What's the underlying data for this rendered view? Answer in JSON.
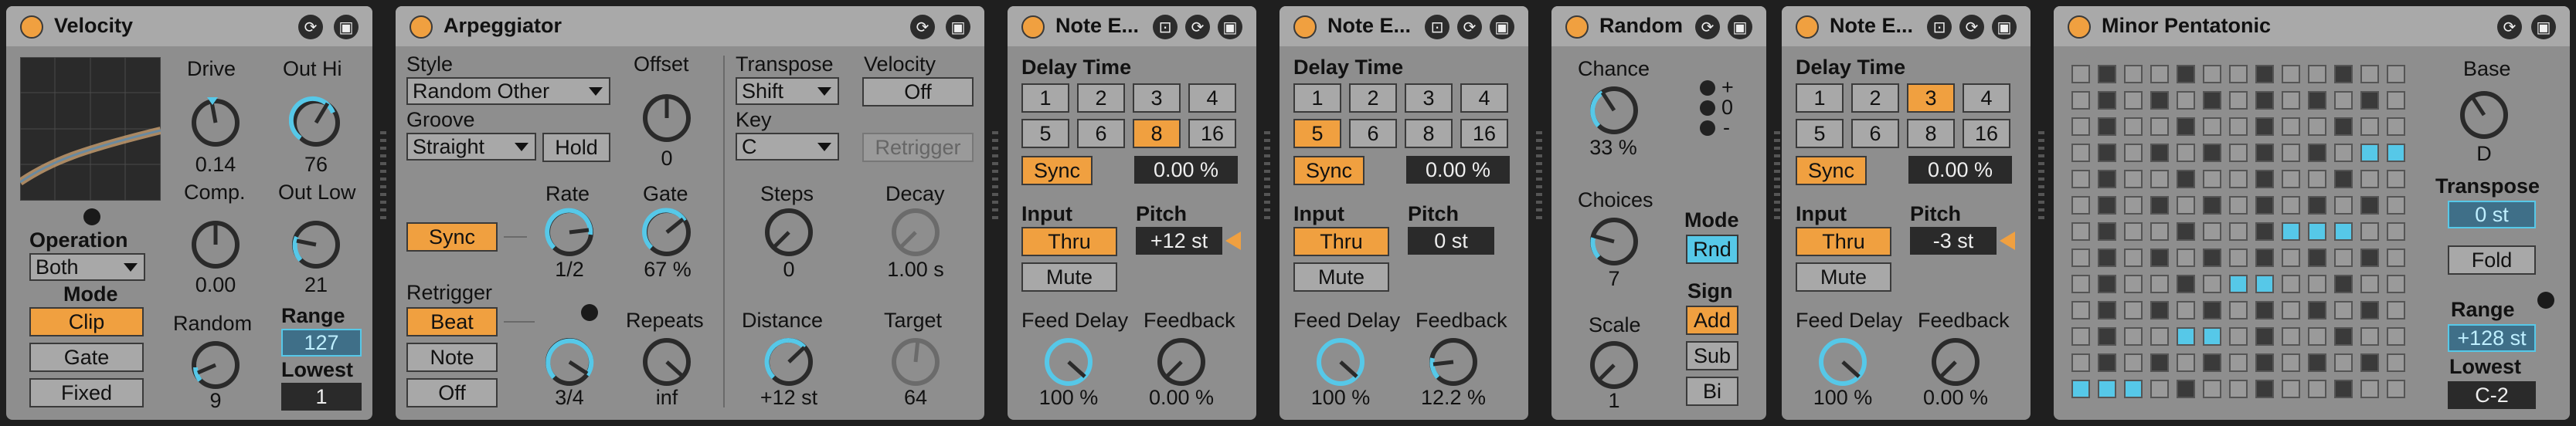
{
  "accent": "#f0a040",
  "blue": "#56c8e8",
  "velocity": {
    "title": "Velocity",
    "drive": {
      "label": "Drive",
      "value": "0.14"
    },
    "out_hi": {
      "label": "Out Hi",
      "value": "76"
    },
    "comp": {
      "label": "Comp.",
      "value": "0.00"
    },
    "out_low": {
      "label": "Out Low",
      "value": "21"
    },
    "operation": {
      "label": "Operation",
      "value": "Both"
    },
    "mode": {
      "label": "Mode",
      "options": [
        "Clip",
        "Gate",
        "Fixed"
      ],
      "selected": "Clip"
    },
    "random": {
      "label": "Random",
      "value": "9"
    },
    "range": {
      "label": "Range",
      "value": "127"
    },
    "lowest": {
      "label": "Lowest",
      "value": "1"
    }
  },
  "arp": {
    "title": "Arpeggiator",
    "style": {
      "label": "Style",
      "value": "Random Other"
    },
    "groove": {
      "label": "Groove",
      "value": "Straight"
    },
    "hold": "Hold",
    "offset": {
      "label": "Offset",
      "value": "0"
    },
    "sync": "Sync",
    "rate": {
      "label": "Rate",
      "value": "1/2"
    },
    "gate": {
      "label": "Gate",
      "value": "67 %"
    },
    "retrigger": {
      "label": "Retrigger",
      "options": [
        "Beat",
        "Note",
        "Off"
      ],
      "selected": "Beat"
    },
    "repeats": {
      "label": "Repeats",
      "value": "inf"
    },
    "retrig_rate": {
      "value": "3/4"
    },
    "transpose": {
      "label": "Transpose",
      "value": "Shift"
    },
    "key": {
      "label": "Key",
      "value": "C"
    },
    "steps": {
      "label": "Steps",
      "value": "0"
    },
    "distance": {
      "label": "Distance",
      "value": "+12 st"
    },
    "velocity": {
      "label": "Velocity",
      "value": "Off"
    },
    "retrigger_btn": "Retrigger",
    "decay": {
      "label": "Decay",
      "value": "1.00 s"
    },
    "target": {
      "label": "Target",
      "value": "64"
    }
  },
  "echo1": {
    "title": "Note E...",
    "delay_label": "Delay Time",
    "steps": [
      "1",
      "2",
      "3",
      "4",
      "5",
      "6",
      "8",
      "16"
    ],
    "selected": "8",
    "sync": "Sync",
    "time": "0.00 %",
    "input_label": "Input",
    "input": "Thru",
    "mute": "Mute",
    "pitch_label": "Pitch",
    "pitch": "+12 st",
    "feed_label": "Feed Delay",
    "feed": "100 %",
    "fb_label": "Feedback",
    "fb": "0.00 %"
  },
  "echo2": {
    "title": "Note E...",
    "delay_label": "Delay Time",
    "steps": [
      "1",
      "2",
      "3",
      "4",
      "5",
      "6",
      "8",
      "16"
    ],
    "selected": "5",
    "sync": "Sync",
    "time": "0.00 %",
    "input_label": "Input",
    "input": "Thru",
    "mute": "Mute",
    "pitch_label": "Pitch",
    "pitch": "0 st",
    "feed_label": "Feed Delay",
    "feed": "100 %",
    "fb_label": "Feedback",
    "fb": "12.2 %"
  },
  "random": {
    "title": "Random",
    "chance": {
      "label": "Chance",
      "value": "33 %"
    },
    "plus": "+",
    "zero": "0",
    "minus": "-",
    "choices": {
      "label": "Choices",
      "value": "7"
    },
    "mode": {
      "label": "Mode",
      "value": "Rnd"
    },
    "scale": {
      "label": "Scale",
      "value": "1"
    },
    "sign": {
      "label": "Sign",
      "options": [
        "Add",
        "Sub",
        "Bi"
      ],
      "selected": "Add"
    }
  },
  "echo3": {
    "title": "Note E...",
    "delay_label": "Delay Time",
    "steps": [
      "1",
      "2",
      "3",
      "4",
      "5",
      "6",
      "8",
      "16"
    ],
    "selected": "3",
    "sync": "Sync",
    "time": "0.00 %",
    "input_label": "Input",
    "input": "Thru",
    "mute": "Mute",
    "pitch_label": "Pitch",
    "pitch": "-3 st",
    "feed_label": "Feed Delay",
    "feed": "100 %",
    "fb_label": "Feedback",
    "fb": "0.00 %"
  },
  "scale": {
    "title": "Minor Pentatonic",
    "base": {
      "label": "Base",
      "value": "D"
    },
    "transpose": {
      "label": "Transpose",
      "value": "0 st"
    },
    "fold": "Fold",
    "range": {
      "label": "Range",
      "value": "+128 st"
    },
    "lowest": {
      "label": "Lowest",
      "value": "C-2"
    }
  }
}
